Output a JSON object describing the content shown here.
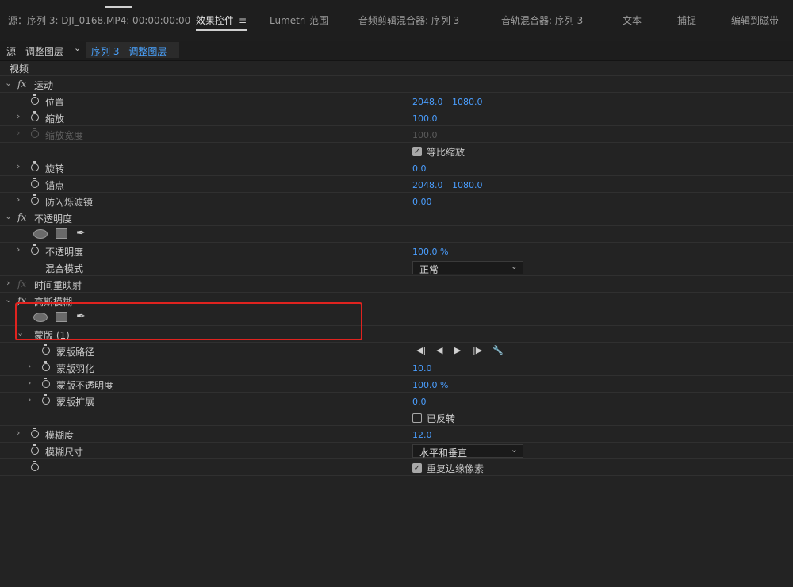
{
  "tabs": {
    "source": "源：序列 3: DJI_0168.MP4: 00:00:00:00",
    "effect_controls": "效果控件",
    "lumetri": "Lumetri 范围",
    "audio_clip_mixer": "音频剪辑混合器: 序列 3",
    "audio_track_mixer": "音轨混合器: 序列 3",
    "text": "文本",
    "capture": "捕捉",
    "edit_to_tape": "编辑到磁带",
    "menu_icon": "hamburger-icon"
  },
  "subheader": {
    "source_label": "源 - 调整图层",
    "sequence_label": "序列 3 - 调整图层"
  },
  "video_section": "视频",
  "motion": {
    "title": "运动",
    "position": {
      "label": "位置",
      "x": "2048.0",
      "y": "1080.0"
    },
    "scale": {
      "label": "缩放",
      "value": "100.0"
    },
    "scale_width": {
      "label": "缩放宽度",
      "value": "100.0"
    },
    "uniform_scale": {
      "label": "等比缩放",
      "checked": true
    },
    "rotation": {
      "label": "旋转",
      "value": "0.0"
    },
    "anchor": {
      "label": "锚点",
      "x": "2048.0",
      "y": "1080.0"
    },
    "anti_flicker": {
      "label": "防闪烁滤镜",
      "value": "0.00"
    }
  },
  "opacity": {
    "title": "不透明度",
    "opacity": {
      "label": "不透明度",
      "value": "100.0 %"
    },
    "blend_mode": {
      "label": "混合模式",
      "value": "正常"
    }
  },
  "time_remap": {
    "title": "时间重映射"
  },
  "gaussian_blur": {
    "title": "高斯模糊",
    "mask": {
      "title": "蒙版 (1)",
      "path": {
        "label": "蒙版路径"
      },
      "feather": {
        "label": "蒙版羽化",
        "value": "10.0"
      },
      "opacity": {
        "label": "蒙版不透明度",
        "value": "100.0 %"
      },
      "expansion": {
        "label": "蒙版扩展",
        "value": "0.0"
      },
      "inverted": {
        "label": "已反转",
        "checked": false
      }
    },
    "blurriness": {
      "label": "模糊度",
      "value": "12.0"
    },
    "dimensions": {
      "label": "模糊尺寸",
      "value": "水平和垂直"
    },
    "repeat_edge": {
      "label": "重复边缘像素",
      "checked": true
    }
  },
  "fx_symbol": "fx",
  "colors": {
    "accent": "#4a9eff",
    "highlight": "#e0231f"
  }
}
